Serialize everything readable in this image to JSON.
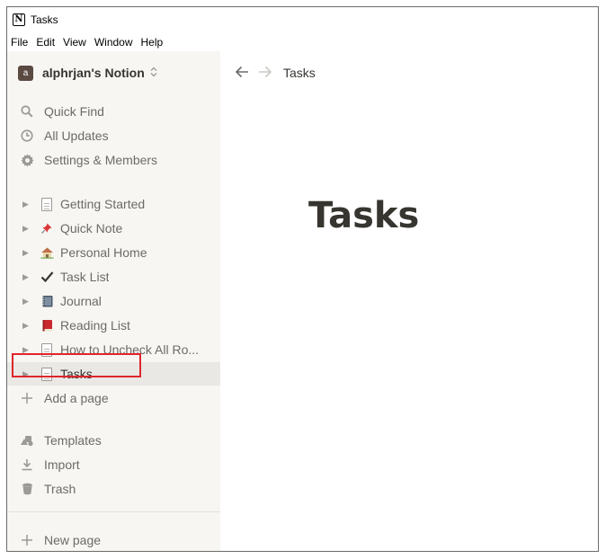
{
  "window": {
    "title": "Tasks"
  },
  "menu": [
    "File",
    "Edit",
    "View",
    "Window",
    "Help"
  ],
  "workspace": {
    "avatar_letter": "a",
    "name": "alphrjan's Notion"
  },
  "sidebar_actions": [
    {
      "icon": "search-icon",
      "label": "Quick Find"
    },
    {
      "icon": "clock-icon",
      "label": "All Updates"
    },
    {
      "icon": "gear-icon",
      "label": "Settings & Members"
    }
  ],
  "pages": [
    {
      "icon": "page-icon",
      "label": "Getting Started"
    },
    {
      "icon": "pushpin-icon",
      "label": "Quick Note"
    },
    {
      "icon": "house-icon",
      "label": "Personal Home"
    },
    {
      "icon": "checkmark-icon",
      "label": "Task List"
    },
    {
      "icon": "notebook-icon",
      "label": "Journal"
    },
    {
      "icon": "book-icon",
      "label": "Reading List"
    },
    {
      "icon": "page-icon",
      "label": "How to Uncheck All Ro..."
    },
    {
      "icon": "page-icon",
      "label": "Tasks",
      "active": true
    }
  ],
  "add_page": {
    "label": "Add a page"
  },
  "sidebar_bottom": [
    {
      "icon": "templates-icon",
      "label": "Templates"
    },
    {
      "icon": "import-icon",
      "label": "Import"
    },
    {
      "icon": "trash-icon",
      "label": "Trash"
    }
  ],
  "new_page": {
    "label": "New page"
  },
  "breadcrumb": {
    "current": "Tasks"
  },
  "page": {
    "title": "Tasks"
  }
}
